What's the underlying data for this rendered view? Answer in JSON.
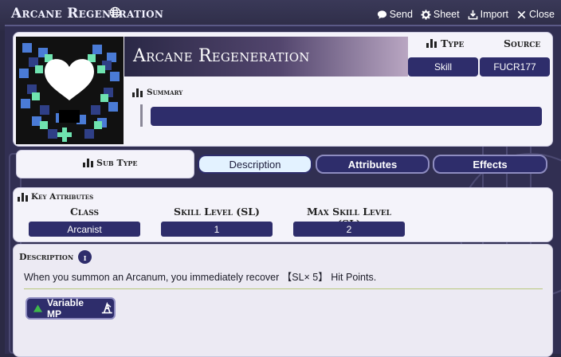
{
  "window": {
    "title": "Arcane Regeneration",
    "actions": {
      "send": "Send",
      "sheet": "Sheet",
      "import": "Import",
      "close": "Close"
    }
  },
  "header": {
    "name": "Arcane Regeneration",
    "type_label": "Type",
    "source_label": "Source",
    "type_value": "Skill",
    "source_value": "FUCR177",
    "summary_label": "Summary",
    "summary_value": ""
  },
  "tabs": {
    "subtype_label": "Sub Type",
    "items": [
      {
        "label": "Description",
        "active": true
      },
      {
        "label": "Attributes",
        "active": false
      },
      {
        "label": "Effects",
        "active": false
      }
    ]
  },
  "key_attributes": {
    "label": "Key Attributes",
    "columns": [
      {
        "header": "Class",
        "value": "Arcanist"
      },
      {
        "header": "Skill Level (SL)",
        "value": "1"
      },
      {
        "header": "Max Skill Level (SL)",
        "value": "2"
      }
    ]
  },
  "description": {
    "label": "Description",
    "text": "When you summon an Arcanum, you immediately recover 【SL× 5】 Hit Points.",
    "button_label": "Variable MP"
  },
  "colors": {
    "panel_dark": "#2e2d6b",
    "accent_green": "#3db84b",
    "card_bg": "#f4f3fa"
  }
}
